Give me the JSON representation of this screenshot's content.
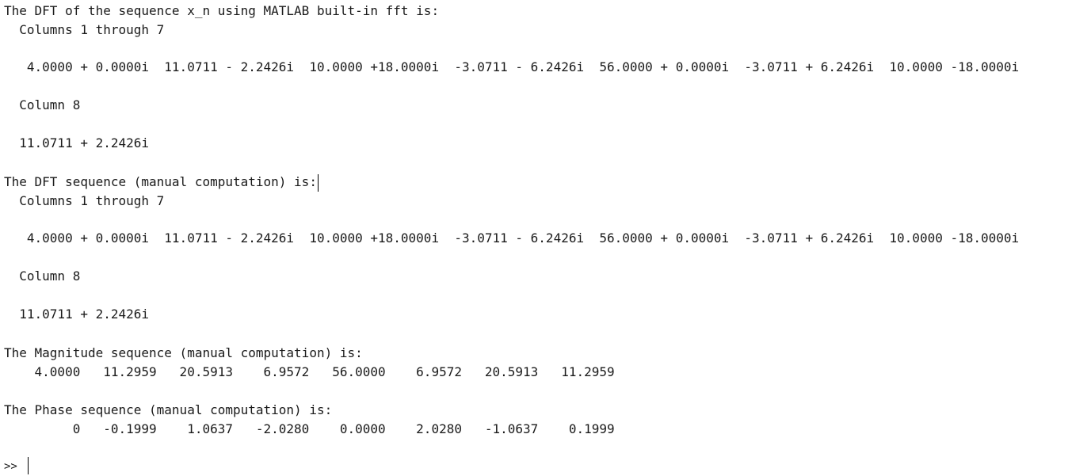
{
  "console": {
    "fft_header": "The DFT of the sequence x_n using MATLAB built-in fft is:",
    "fft_cols_header": "  Columns 1 through 7",
    "fft_cols_values": "   4.0000 + 0.0000i  11.0711 - 2.2426i  10.0000 +18.0000i  -3.0711 - 6.2426i  56.0000 + 0.0000i  -3.0711 + 6.2426i  10.0000 -18.0000i",
    "fft_col8_header": "  Column 8",
    "fft_col8_value": "  11.0711 + 2.2426i",
    "manual_header": "The DFT sequence (manual computation) is:",
    "manual_cols_header": "  Columns 1 through 7",
    "manual_cols_values": "   4.0000 + 0.0000i  11.0711 - 2.2426i  10.0000 +18.0000i  -3.0711 - 6.2426i  56.0000 + 0.0000i  -3.0711 + 6.2426i  10.0000 -18.0000i",
    "manual_col8_header": "  Column 8",
    "manual_col8_value": "  11.0711 + 2.2426i",
    "magnitude_header": "The Magnitude sequence (manual computation) is:",
    "magnitude_values": "    4.0000   11.2959   20.5913    6.9572   56.0000    6.9572   20.5913   11.2959",
    "phase_header": "The Phase sequence (manual computation) is:",
    "phase_values": "         0   -0.1999    1.0637   -2.0280    0.0000    2.0280   -1.0637    0.1999",
    "prompt": ">> "
  }
}
